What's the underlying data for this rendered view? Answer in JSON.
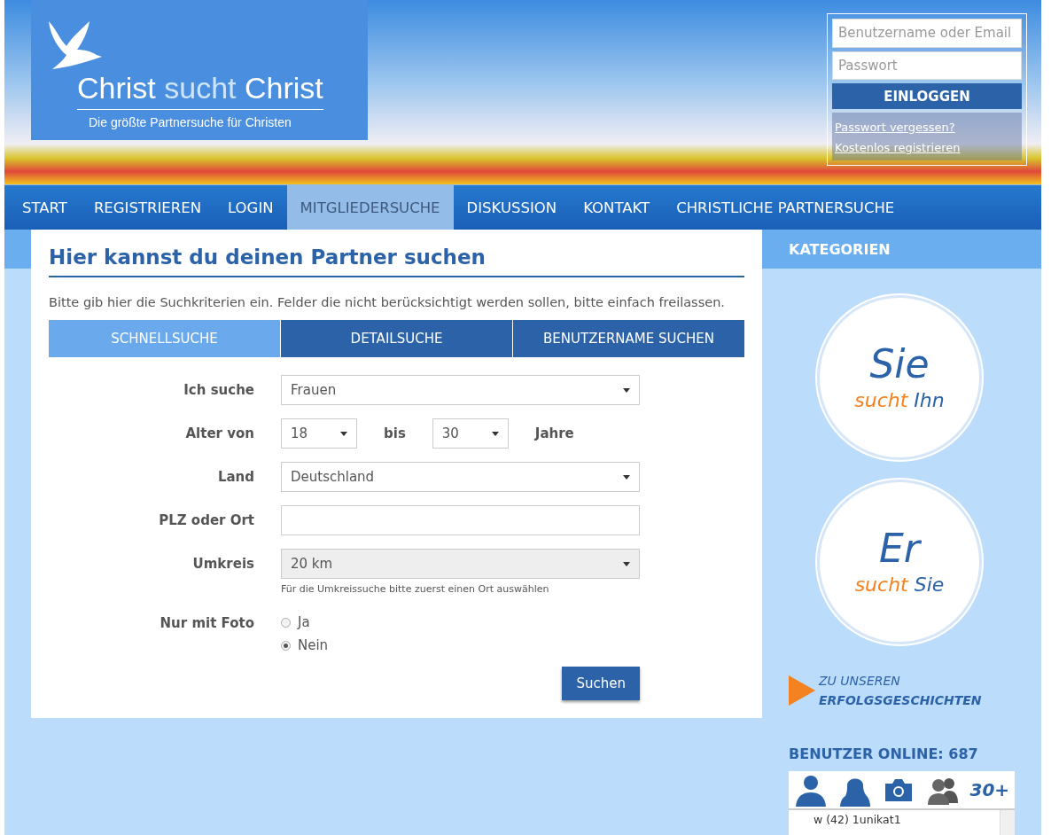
{
  "header": {
    "logo": {
      "title": [
        {
          "text": "Christ",
          "accent": false
        },
        {
          "text": "sucht",
          "accent": true
        },
        {
          "text": "Christ",
          "accent": false
        }
      ],
      "tagline": "Die größte Partnersuche für Christen"
    },
    "login": {
      "username": {
        "placeholder": "Benutzername oder Email"
      },
      "password": {
        "placeholder": "Passwort"
      },
      "button": "EINLOGGEN",
      "links": [
        "Passwort vergessen?",
        "Kostenlos registrieren"
      ]
    }
  },
  "nav": {
    "items": [
      {
        "label": "START",
        "selected": false
      },
      {
        "label": "REGISTRIEREN",
        "selected": false
      },
      {
        "label": "LOGIN",
        "selected": false
      },
      {
        "label": "MITGLIEDERSUCHE",
        "selected": true
      },
      {
        "label": "DISKUSSION",
        "selected": false
      },
      {
        "label": "KONTAKT",
        "selected": false
      },
      {
        "label": "CHRISTLICHE PARTNERSUCHE",
        "selected": false
      }
    ]
  },
  "main": {
    "heading": "Hier kannst du deinen Partner suchen",
    "intro": "Bitte gib hier die Suchkriterien ein. Felder die nicht berücksichtigt werden sollen, bitte einfach freilassen.",
    "tabs": [
      {
        "label": "SCHNELLSUCHE",
        "selected": true
      },
      {
        "label": "DETAILSUCHE",
        "selected": false
      },
      {
        "label": "BENUTZERNAME SUCHEN",
        "selected": false
      }
    ],
    "form": [
      {
        "kind": "select",
        "label": "Ich suche",
        "value": "Frauen",
        "disabled": false
      },
      {
        "kind": "range",
        "label": "Alter von",
        "from": "18",
        "separator": "bis",
        "to": "30",
        "unit": "Jahre"
      },
      {
        "kind": "select",
        "label": "Land",
        "value": "Deutschland",
        "disabled": false
      },
      {
        "kind": "text",
        "label": "PLZ oder Ort"
      },
      {
        "kind": "select",
        "label": "Umkreis",
        "value": "20 km",
        "disabled": true,
        "hint": "Für die Umkreissuche bitte zuerst einen Ort auswählen"
      },
      {
        "kind": "radio",
        "label": "Nur mit Foto",
        "options": [
          {
            "label": "Ja",
            "selected": false
          },
          {
            "label": "Nein",
            "selected": true
          }
        ]
      }
    ],
    "submit": "Suchen"
  },
  "sidebar": {
    "heading": "KATEGORIEN",
    "categories": [
      {
        "title": "Sie",
        "verb": "sucht",
        "object": "Ihn"
      },
      {
        "title": "Er",
        "verb": "sucht",
        "object": "Sie"
      }
    ],
    "stories_link": "ZU UNSEREN **ERFOLGSGESCHICHTEN**",
    "online": {
      "title": "BENUTZER ONLINE: 687",
      "filters": [
        {
          "kind": "man"
        },
        {
          "kind": "woman"
        },
        {
          "kind": "camera"
        },
        {
          "kind": "group"
        },
        {
          "kind": "text",
          "label": "30+"
        }
      ],
      "users": [
        "w (42) 1unikat1"
      ]
    }
  }
}
